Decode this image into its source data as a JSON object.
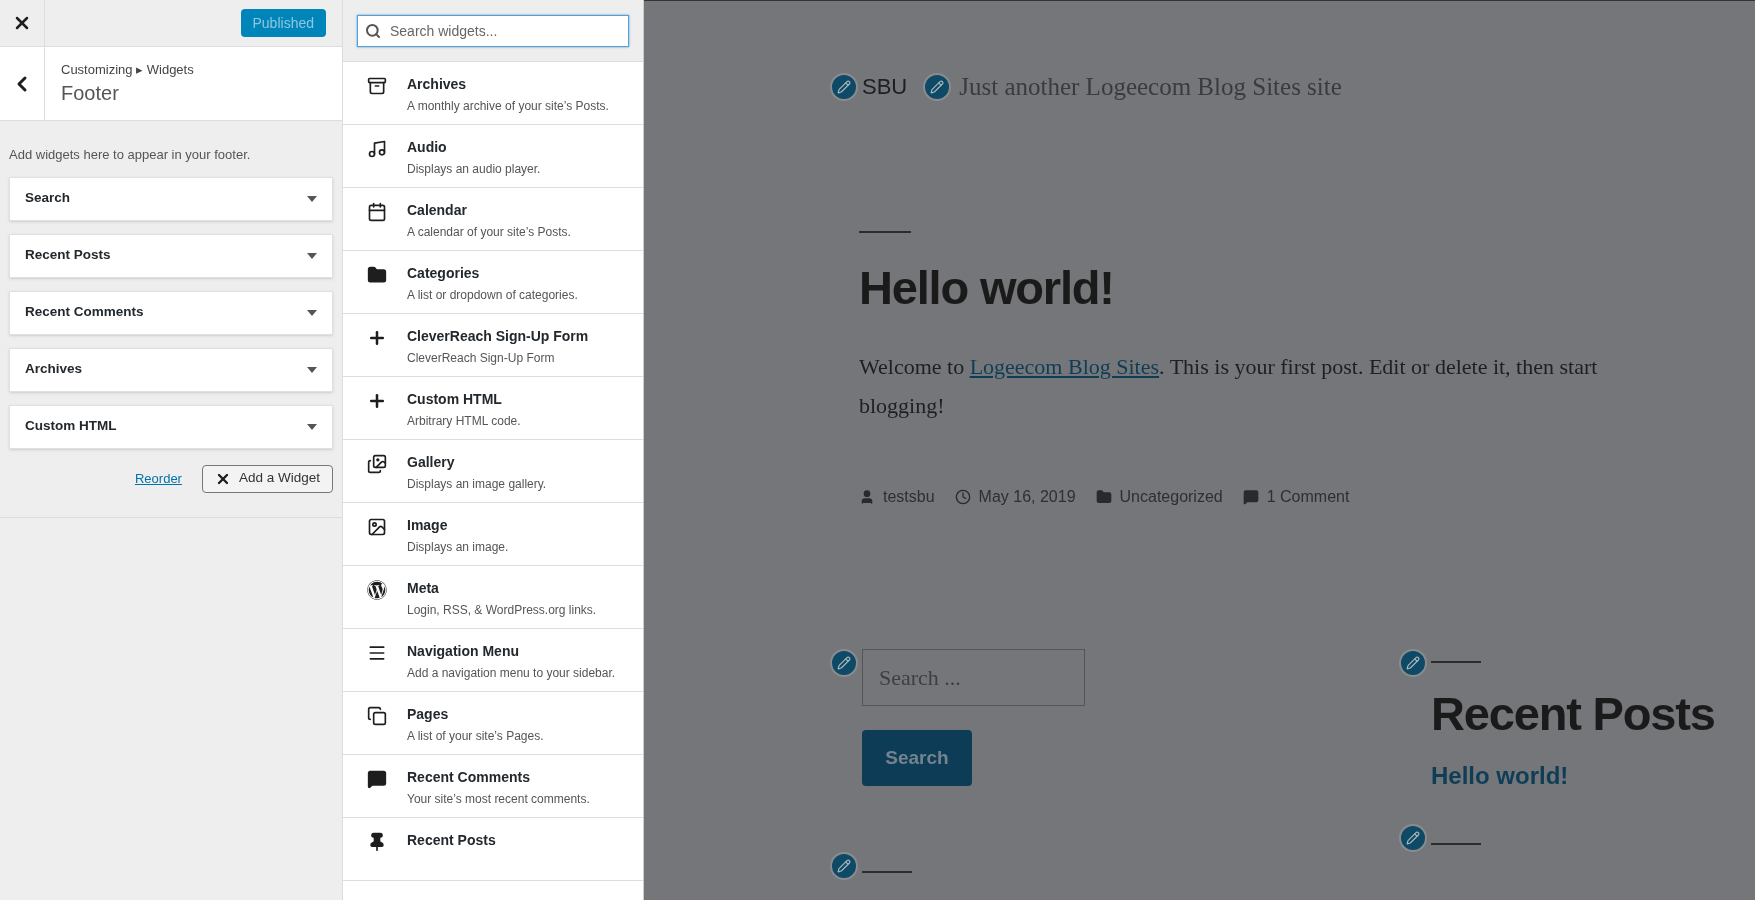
{
  "top_bar": {
    "publish_button": "Published"
  },
  "section": {
    "breadcrumb": "Customizing ▸ Widgets",
    "title": "Footer"
  },
  "description": "Add widgets here to appear in your footer.",
  "widgets": [
    {
      "title": "Search",
      "expanded": false
    },
    {
      "title": "Recent Posts",
      "expanded": false
    },
    {
      "title": "Recent Comments",
      "expanded": false
    },
    {
      "title": "Archives",
      "expanded": false
    },
    {
      "title": "Custom HTML",
      "expanded": false
    }
  ],
  "reorder_link": "Reorder",
  "add_widget_button": "Add a Widget",
  "available_widgets": {
    "search_placeholder": "Search widgets...",
    "items": [
      {
        "kind": "archive",
        "title": "Archives",
        "description": "A monthly archive of your site’s Posts."
      },
      {
        "kind": "audio",
        "title": "Audio",
        "description": "Displays an audio player."
      },
      {
        "kind": "calendar",
        "title": "Calendar",
        "description": "A calendar of your site’s Posts."
      },
      {
        "kind": "folder",
        "title": "Categories",
        "description": "A list or dropdown of categories."
      },
      {
        "kind": "plus",
        "title": "CleverReach Sign-Up Form",
        "description": "CleverReach Sign-Up Form"
      },
      {
        "kind": "plus",
        "title": "Custom HTML",
        "description": "Arbitrary HTML code."
      },
      {
        "kind": "gallery",
        "title": "Gallery",
        "description": "Displays an image gallery."
      },
      {
        "kind": "image",
        "title": "Image",
        "description": "Displays an image."
      },
      {
        "kind": "wordpress",
        "title": "Meta",
        "description": "Login, RSS, & WordPress.org links."
      },
      {
        "kind": "menu",
        "title": "Navigation Menu",
        "description": "Add a navigation menu to your sidebar."
      },
      {
        "kind": "pages",
        "title": "Pages",
        "description": "A list of your site’s Pages."
      },
      {
        "kind": "comment",
        "title": "Recent Comments",
        "description": "Your site’s most recent comments."
      },
      {
        "kind": "pin",
        "title": "Recent Posts"
      }
    ]
  },
  "preview": {
    "site_title": "SBU",
    "tagline": "Just another Logeecom Blog Sites site",
    "post": {
      "title": "Hello world!",
      "body_before": "Welcome to ",
      "body_link": "Logeecom Blog Sites",
      "body_after": ". This is your first post. Edit or delete it, then start blogging!",
      "meta": [
        {
          "kind": "author",
          "text": "testsbu"
        },
        {
          "kind": "date",
          "text": "May 16, 2019"
        },
        {
          "kind": "category",
          "text": "Uncategorized"
        },
        {
          "kind": "comments",
          "text": "1 Comment"
        }
      ]
    },
    "search_widget": {
      "placeholder": "Search ...",
      "button": "Search"
    },
    "recent_posts": {
      "title": "Recent Posts",
      "items": [
        "Hello world!"
      ]
    }
  }
}
